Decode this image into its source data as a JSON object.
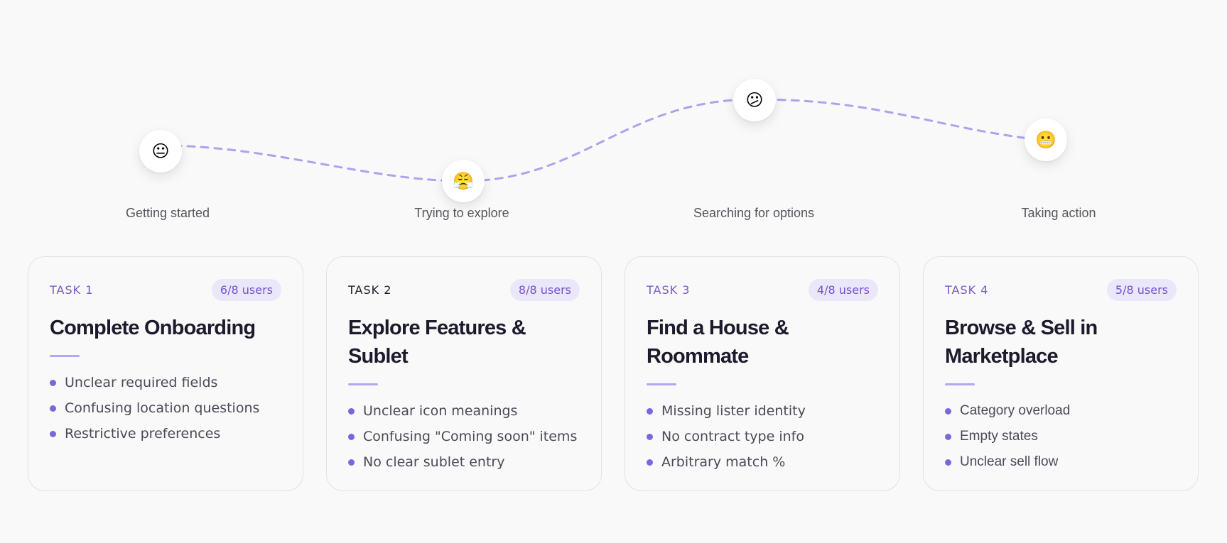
{
  "journey": {
    "stages": [
      {
        "label": "Getting started",
        "emoji": "😐",
        "icon": "neutral-face-icon"
      },
      {
        "label": "Trying to explore",
        "emoji": "😤",
        "icon": "frustrated-face-icon"
      },
      {
        "label": "Searching for options",
        "emoji": "😕",
        "icon": "confused-face-icon"
      },
      {
        "label": "Taking action",
        "emoji": "😬",
        "icon": "grimacing-face-icon"
      }
    ],
    "line_color": "#aba3ee"
  },
  "tasks": [
    {
      "label": "TASK 1",
      "users": "6/8 users",
      "title_lines": [
        "Complete Onboarding"
      ],
      "issues": [
        "Unclear required fields",
        "Confusing location questions",
        "Restrictive preferences"
      ]
    },
    {
      "label": "TASK 2",
      "users": "8/8 users",
      "title_lines": [
        "Explore Features &",
        "Sublet"
      ],
      "issues": [
        "Unclear icon meanings",
        "Confusing \"Coming soon\" items",
        "No clear sublet entry"
      ]
    },
    {
      "label": "TASK 3",
      "users": "4/8 users",
      "title_lines": [
        "Find a House &",
        "Roommate"
      ],
      "issues": [
        "Missing lister identity",
        "No contract type info",
        "Arbitrary match %"
      ]
    },
    {
      "label": "TASK 4",
      "users": "5/8 users",
      "title_lines": [
        "Browse & Sell in",
        "Marketplace"
      ],
      "issues": [
        "Category overload",
        "Empty states",
        "Unclear sell flow"
      ]
    }
  ],
  "colors": {
    "accent": "#7858c8",
    "badge_bg": "#ebe7fb",
    "bullet": "#7d66dd",
    "divider": "#b3a6f2",
    "title": "#1b1b2c"
  }
}
